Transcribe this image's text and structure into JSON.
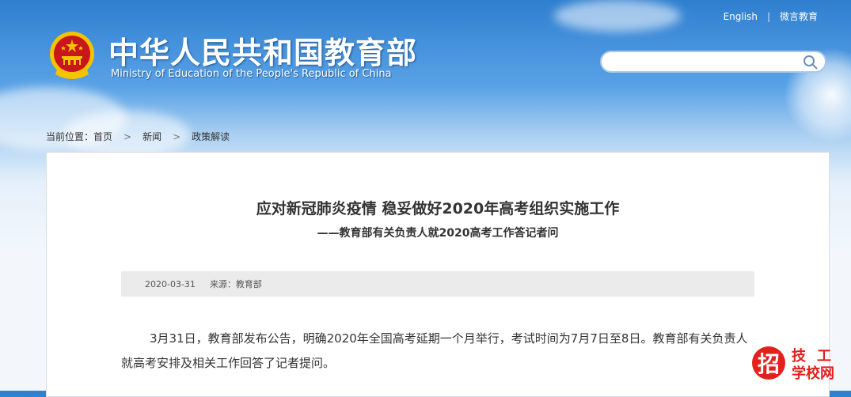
{
  "top_nav": {
    "english": "English",
    "separator": "|",
    "weiyan": "微言教育"
  },
  "header": {
    "title_cn": "中华人民共和国教育部",
    "title_en": "Ministry of Education of the People's Republic of China"
  },
  "search": {
    "placeholder": ""
  },
  "breadcrumb": {
    "prefix": "当前位置：",
    "items": [
      "首页",
      "新闻",
      "政策解读"
    ]
  },
  "article": {
    "title": "应对新冠肺炎疫情 稳妥做好2020年高考组织实施工作",
    "subtitle": "——教育部有关负责人就2020高考工作答记者问",
    "date": "2020-03-31",
    "source": "来源：教育部",
    "paragraph": "3月31日，教育部发布公告，明确2020年全国高考延期一个月举行，考试时间为7月7日至8日。教育部有关负责人就高考安排及相关工作回答了记者提问。"
  },
  "watermark": {
    "logo": "招",
    "line1": "技工",
    "line2": "学校网"
  },
  "colors": {
    "sky_top": "#2f7fd0",
    "emblem_red": "#c8161d",
    "emblem_gold": "#f5c400",
    "watermark_red": "#e2211c"
  }
}
